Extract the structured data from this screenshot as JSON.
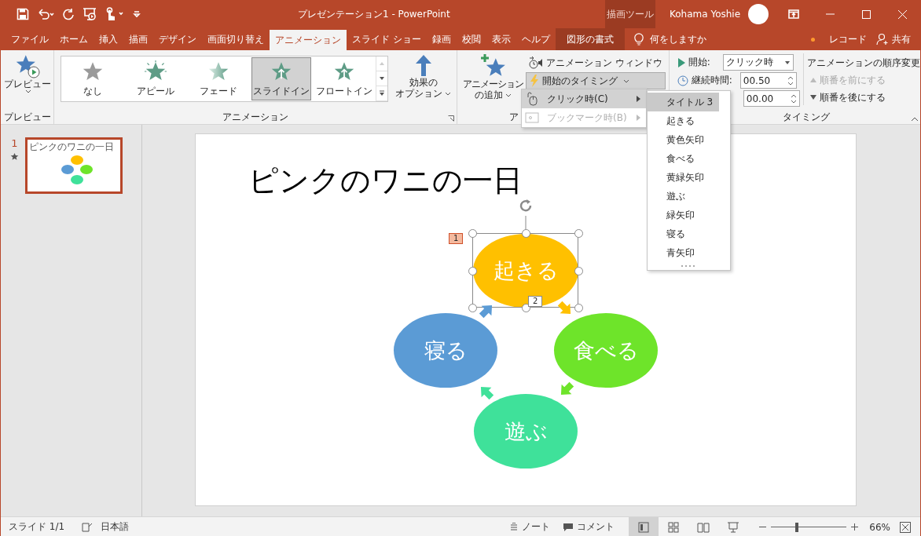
{
  "window": {
    "title": "プレゼンテーション1 - PowerPoint",
    "context_tab_group": "描画ツール",
    "user": "Kohama Yoshie"
  },
  "tabs": [
    {
      "label": "ファイル",
      "selected": false,
      "kind": "normal"
    },
    {
      "label": "ホーム",
      "selected": false,
      "kind": "normal"
    },
    {
      "label": "挿入",
      "selected": false,
      "kind": "normal"
    },
    {
      "label": "描画",
      "selected": false,
      "kind": "normal"
    },
    {
      "label": "デザイン",
      "selected": false,
      "kind": "normal"
    },
    {
      "label": "画面切り替え",
      "selected": false,
      "kind": "normal"
    },
    {
      "label": "アニメーション",
      "selected": true,
      "kind": "normal"
    },
    {
      "label": "スライド ショー",
      "selected": false,
      "kind": "normal"
    },
    {
      "label": "録画",
      "selected": false,
      "kind": "normal"
    },
    {
      "label": "校閲",
      "selected": false,
      "kind": "normal"
    },
    {
      "label": "表示",
      "selected": false,
      "kind": "normal"
    },
    {
      "label": "ヘルプ",
      "selected": false,
      "kind": "normal"
    },
    {
      "label": "図形の書式",
      "selected": false,
      "kind": "context"
    }
  ],
  "tell_me": {
    "placeholder": "何をしますか"
  },
  "record_button": "レコード",
  "share_button": "共有",
  "ribbon": {
    "preview": {
      "button": "プレビュー",
      "group_label": "プレビュー"
    },
    "animation": {
      "group_label": "アニメーション",
      "effect_options": {
        "line_1": "効果の",
        "line_2": "オプション"
      },
      "gallery": [
        {
          "label": "なし",
          "kind": "none",
          "selected": false
        },
        {
          "label": "アピール",
          "kind": "appear",
          "selected": false
        },
        {
          "label": "フェード",
          "kind": "fade",
          "selected": false
        },
        {
          "label": "スライドイン",
          "kind": "fly",
          "selected": true
        },
        {
          "label": "フロートイン",
          "kind": "float",
          "selected": false
        }
      ]
    },
    "advanced": {
      "group_label": "ア",
      "add_animation": {
        "line_1": "アニメーション",
        "line_2": "の追加"
      },
      "animation_pane": "アニメーション ウィンドウ",
      "trigger": {
        "label": "開始のタイミング",
        "pressed": true
      }
    },
    "timing": {
      "group_label": "タイミング",
      "start_label": "開始:",
      "start_value": "クリック時",
      "duration_label": "継続時間:",
      "duration_value": "00.50",
      "delay_value": "00.00",
      "reorder_title": "アニメーションの順序変更",
      "move_earlier": {
        "label": "順番を前にする",
        "disabled": true
      },
      "move_later": {
        "label": "順番を後にする",
        "disabled": false
      }
    }
  },
  "trigger_menu": {
    "items": [
      {
        "label": "クリック時(C)",
        "kind": "click",
        "selected": true,
        "disabled": false
      },
      {
        "label": "ブックマーク時(B)",
        "kind": "bookmark",
        "selected": false,
        "disabled": true
      }
    ],
    "submenu": [
      {
        "label": "タイトル 3",
        "selected": true
      },
      {
        "label": "起きる",
        "selected": false
      },
      {
        "label": "黄色矢印",
        "selected": false
      },
      {
        "label": "食べる",
        "selected": false
      },
      {
        "label": "黄緑矢印",
        "selected": false
      },
      {
        "label": "遊ぶ",
        "selected": false
      },
      {
        "label": "緑矢印",
        "selected": false
      },
      {
        "label": "寝る",
        "selected": false
      },
      {
        "label": "青矢印",
        "selected": false
      }
    ]
  },
  "slides": [
    {
      "number": "1",
      "title": "ピンクのワニの一日",
      "selected": true,
      "animated": true
    }
  ],
  "slide": {
    "title": "ピンクのワニの一日",
    "shapes": [
      {
        "kind": "ellipse",
        "label": "起きる",
        "color": "#ffc000",
        "selected": true
      },
      {
        "kind": "ellipse",
        "label": "食べる",
        "color": "#6ee42a",
        "selected": false
      },
      {
        "kind": "ellipse",
        "label": "寝る",
        "color": "#5b9bd5",
        "selected": false
      },
      {
        "kind": "ellipse",
        "label": "遊ぶ",
        "color": "#3fe19a",
        "selected": false
      },
      {
        "kind": "arrow",
        "color": "#5b9bd5",
        "selected": false
      },
      {
        "kind": "arrow",
        "color": "#ffc000",
        "selected": false
      },
      {
        "kind": "arrow",
        "color": "#6ee42a",
        "selected": false
      },
      {
        "kind": "arrow",
        "color": "#3fe19a",
        "selected": false
      }
    ],
    "animation_tags": [
      {
        "label": "1",
        "selected": true
      },
      {
        "label": "2",
        "selected": false
      }
    ]
  },
  "status_bar": {
    "slide": "スライド 1/1",
    "language": "日本語",
    "notes": "ノート",
    "comments": "コメント",
    "zoom": {
      "level": 0.34,
      "value": "66%"
    },
    "views": [
      {
        "kind": "normal",
        "selected": true
      },
      {
        "kind": "sorter",
        "selected": false
      },
      {
        "kind": "reading",
        "selected": false
      },
      {
        "kind": "show",
        "selected": false
      }
    ]
  }
}
